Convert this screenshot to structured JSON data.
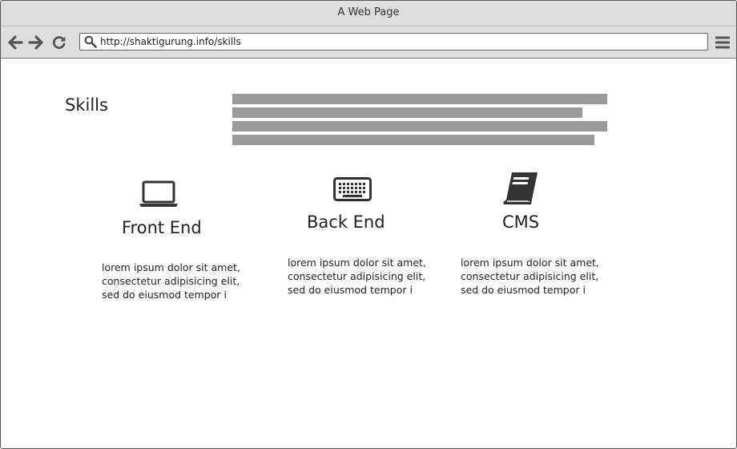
{
  "window": {
    "title": "A Web Page"
  },
  "toolbar": {
    "url": "http://shaktigurung.info/skills"
  },
  "page": {
    "title": "Skills"
  },
  "skills": [
    {
      "icon": "laptop-icon",
      "heading": "Front End",
      "lines": [
        "lorem ipsum dolor sit amet,",
        "consectetur adipisicing elit,",
        "sed do eiusmod tempor i"
      ]
    },
    {
      "icon": "keyboard-icon",
      "heading": "Back End",
      "lines": [
        "lorem ipsum dolor sit amet,",
        "consectetur adipisicing elit,",
        "sed do eiusmod tempor i"
      ]
    },
    {
      "icon": "book-icon",
      "heading": "CMS",
      "lines": [
        "lorem ipsum dolor sit amet,",
        "consectetur adipisicing elit,",
        "sed do eiusmod tempor i"
      ]
    }
  ]
}
